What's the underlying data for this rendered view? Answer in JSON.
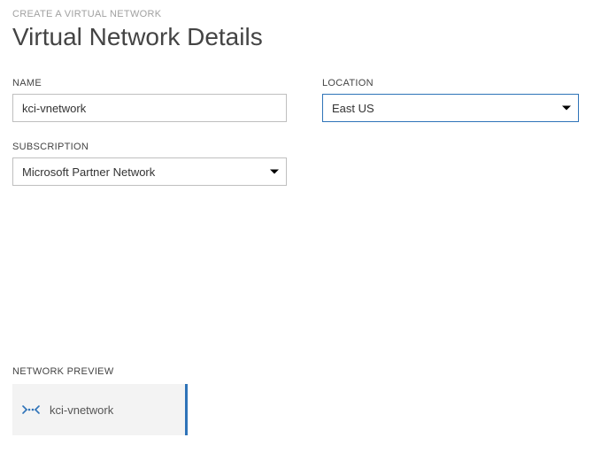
{
  "header": {
    "breadcrumb": "CREATE A VIRTUAL NETWORK",
    "title": "Virtual Network Details"
  },
  "form": {
    "name": {
      "label": "NAME",
      "value": "kci-vnetwork"
    },
    "location": {
      "label": "LOCATION",
      "selected": "East US"
    },
    "subscription": {
      "label": "SUBSCRIPTION",
      "selected": "Microsoft Partner Network"
    }
  },
  "preview": {
    "label": "NETWORK PREVIEW",
    "name": "kci-vnetwork",
    "icon": "virtual-network-icon"
  },
  "colors": {
    "accent": "#2e73b8"
  }
}
